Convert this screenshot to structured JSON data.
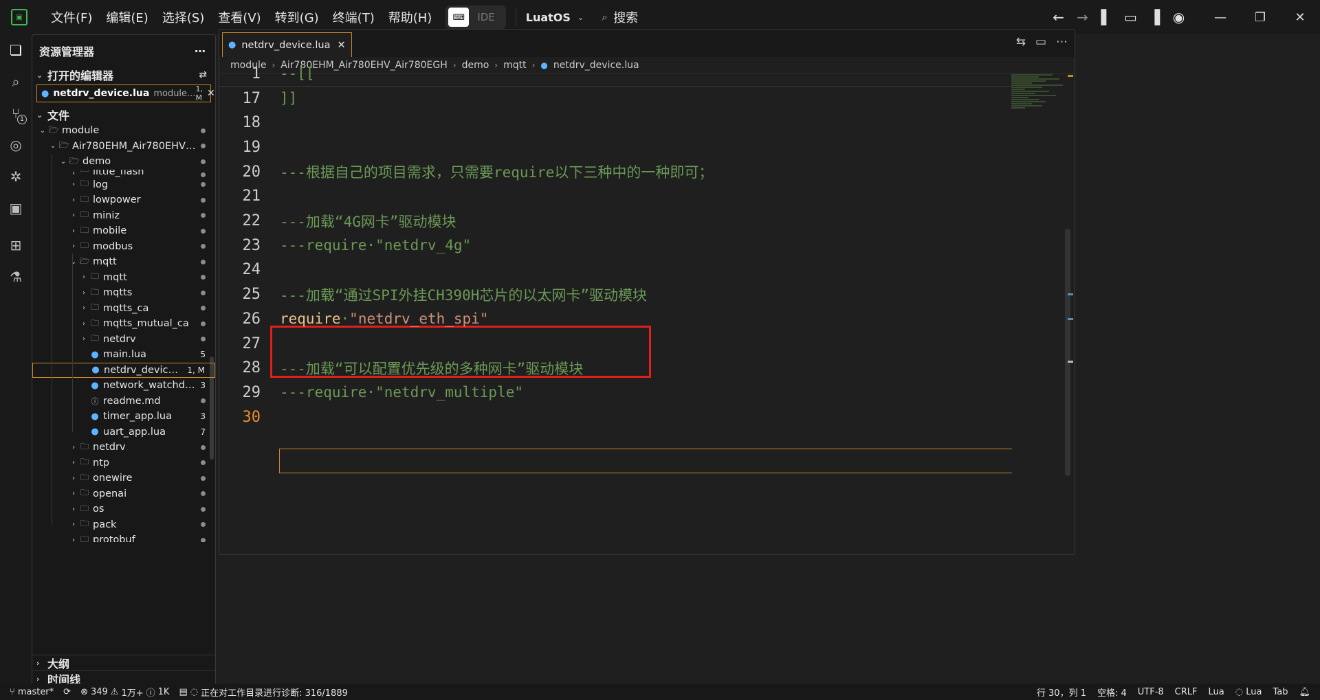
{
  "titlebar": {
    "logo": "luatools-logo",
    "menus": [
      "文件(F)",
      "编辑(E)",
      "选择(S)",
      "查看(V)",
      "转到(G)",
      "终端(T)",
      "帮助(H)"
    ],
    "ide_label": "IDE",
    "project": "LuatOS",
    "search_label": "搜索"
  },
  "sidebar": {
    "title": "资源管理器",
    "open_editors_title": "打开的编辑器",
    "open_editor": {
      "name": "netdrv_device.lua",
      "path": "module...",
      "status": "1, M"
    },
    "files_title": "文件",
    "outline_title": "大纲",
    "timeline_title": "时间线",
    "tree": [
      {
        "label": "module",
        "type": "folder-open",
        "level": 0,
        "count": ""
      },
      {
        "label": "Air780EHM_Air780EHV_Air78...",
        "type": "folder-open",
        "level": 1,
        "count": ""
      },
      {
        "label": "demo",
        "type": "folder-open",
        "level": 2,
        "count": ""
      },
      {
        "label": "little_flash",
        "type": "folder",
        "level": 3,
        "count": ""
      },
      {
        "label": "log",
        "type": "folder",
        "level": 3,
        "count": ""
      },
      {
        "label": "lowpower",
        "type": "folder",
        "level": 3,
        "count": ""
      },
      {
        "label": "miniz",
        "type": "folder",
        "level": 3,
        "count": ""
      },
      {
        "label": "mobile",
        "type": "folder",
        "level": 3,
        "count": ""
      },
      {
        "label": "modbus",
        "type": "folder",
        "level": 3,
        "count": ""
      },
      {
        "label": "mqtt",
        "type": "folder-open",
        "level": 3,
        "count": ""
      },
      {
        "label": "mqtt",
        "type": "folder",
        "level": 4,
        "count": ""
      },
      {
        "label": "mqtts",
        "type": "folder",
        "level": 4,
        "count": ""
      },
      {
        "label": "mqtts_ca",
        "type": "folder",
        "level": 4,
        "count": ""
      },
      {
        "label": "mqtts_mutual_ca",
        "type": "folder",
        "level": 4,
        "count": ""
      },
      {
        "label": "netdrv",
        "type": "folder",
        "level": 4,
        "count": ""
      },
      {
        "label": "main.lua",
        "type": "lua",
        "level": 4,
        "count": "5"
      },
      {
        "label": "netdrv_device.lua",
        "type": "lua",
        "level": 4,
        "count": "1, M"
      },
      {
        "label": "network_watchdog.lua",
        "type": "lua",
        "level": 4,
        "count": "3"
      },
      {
        "label": "readme.md",
        "type": "info",
        "level": 4,
        "count": ""
      },
      {
        "label": "timer_app.lua",
        "type": "lua",
        "level": 4,
        "count": "3"
      },
      {
        "label": "uart_app.lua",
        "type": "lua",
        "level": 4,
        "count": "7"
      },
      {
        "label": "netdrv",
        "type": "folder",
        "level": 3,
        "count": ""
      },
      {
        "label": "ntp",
        "type": "folder",
        "level": 3,
        "count": ""
      },
      {
        "label": "onewire",
        "type": "folder",
        "level": 3,
        "count": ""
      },
      {
        "label": "openai",
        "type": "folder",
        "level": 3,
        "count": ""
      },
      {
        "label": "os",
        "type": "folder",
        "level": 3,
        "count": ""
      },
      {
        "label": "pack",
        "type": "folder",
        "level": 3,
        "count": ""
      },
      {
        "label": "protobuf",
        "type": "folder",
        "level": 3,
        "count": ""
      }
    ]
  },
  "editor": {
    "tab_label": "netdrv_device.lua",
    "breadcrumb": [
      "module",
      "Air780EHM_Air780EHV_Air780EGH",
      "demo",
      "mqtt",
      "netdrv_device.lua"
    ],
    "sticky_line": {
      "num": "1",
      "text": "--[["
    },
    "lines": [
      {
        "num": "17",
        "text": "]]",
        "kind": "comment"
      },
      {
        "num": "18",
        "text": "",
        "kind": "blank"
      },
      {
        "num": "19",
        "text": "",
        "kind": "blank"
      },
      {
        "num": "20",
        "text": "---根据自己的项目需求，只需要require以下三种中的一种即可；",
        "kind": "comment"
      },
      {
        "num": "21",
        "text": "",
        "kind": "blank"
      },
      {
        "num": "22",
        "text": "---加载“4G网卡”驱动模块",
        "kind": "comment"
      },
      {
        "num": "23",
        "text": "---require·\"netdrv_4g\"",
        "kind": "comment"
      },
      {
        "num": "24",
        "text": "",
        "kind": "blank"
      },
      {
        "num": "25",
        "text": "---加载“通过SPI外挂CH390H芯片的以太网卡”驱动模块",
        "kind": "comment"
      },
      {
        "num": "26",
        "text": "require",
        "kind": "code",
        "str": "\"netdrv_eth_spi\""
      },
      {
        "num": "27",
        "text": "",
        "kind": "blank"
      },
      {
        "num": "28",
        "text": "---加载“可以配置优先级的多种网卡”驱动模块",
        "kind": "comment"
      },
      {
        "num": "29",
        "text": "---require·\"netdrv_multiple\"",
        "kind": "comment"
      },
      {
        "num": "30",
        "text": "",
        "kind": "current"
      }
    ]
  },
  "statusbar": {
    "branch": "master*",
    "errors": "349",
    "warnings": "1万+",
    "infos": "1K",
    "diagnostics": "正在对工作目录进行诊断: 316/1889",
    "position": "行 30，列 1",
    "spaces": "空格: 4",
    "encoding": "UTF-8",
    "eol": "CRLF",
    "language": "Lua",
    "lang_server": "Lua",
    "tab": "Tab"
  },
  "colors": {
    "accent_orange": "#c98a2a",
    "highlight_red": "#e0201a",
    "comment": "#6a9955",
    "string": "#ce9178",
    "lua_icon": "#5eb3ff"
  }
}
